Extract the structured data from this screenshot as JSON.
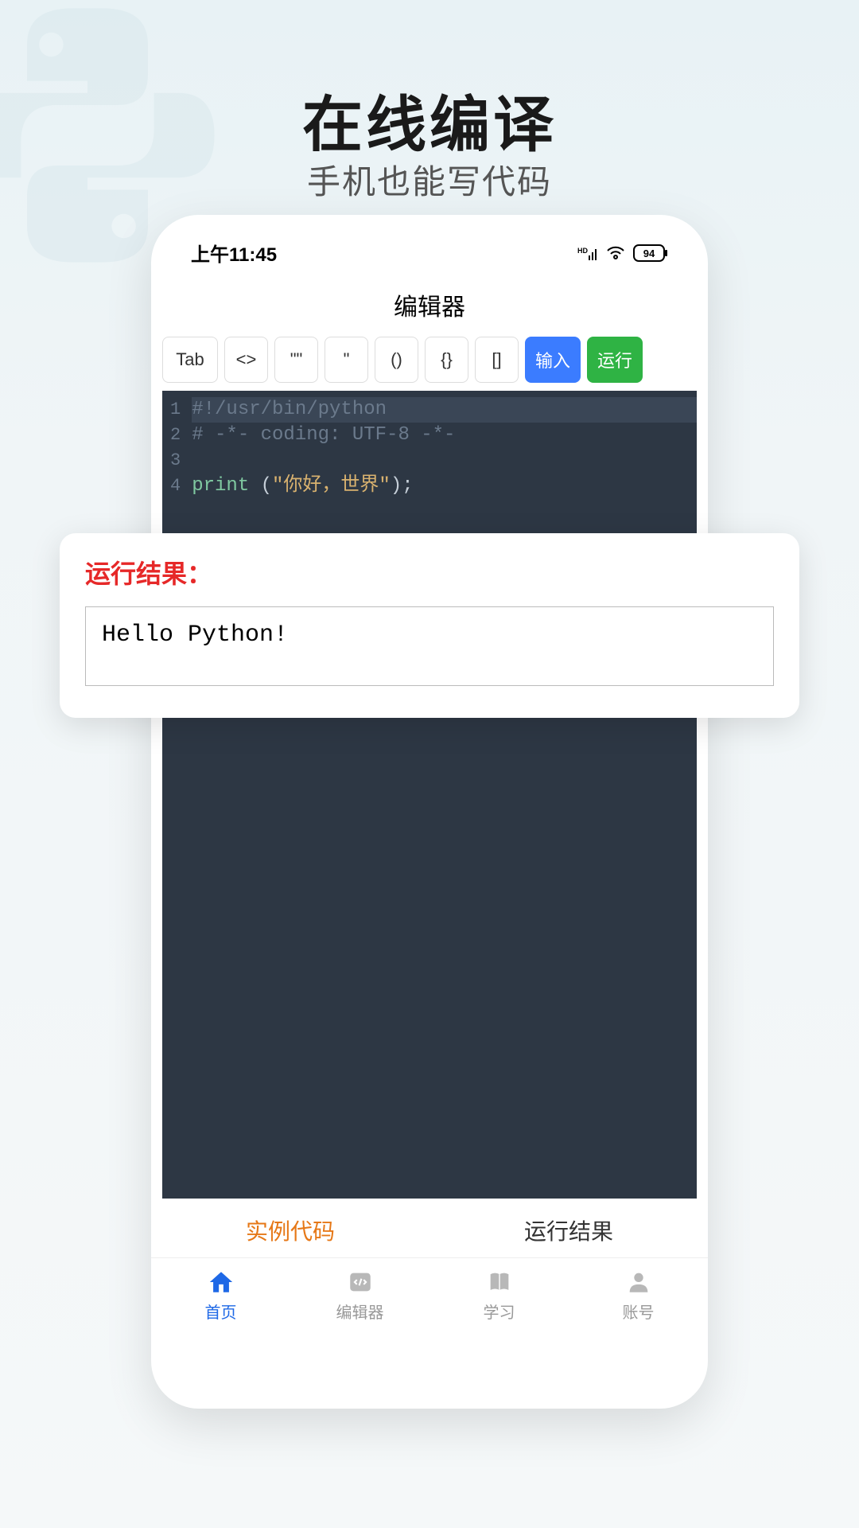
{
  "hero": {
    "title": "在线编译",
    "subtitle": "手机也能写代码"
  },
  "status_bar": {
    "time": "上午11:45",
    "battery": "94"
  },
  "app_title": "编辑器",
  "toolbar": {
    "tab": "Tab",
    "angle": "<>",
    "dquote": "\"\"",
    "squote": "\"",
    "paren": "()",
    "brace": "{}",
    "bracket": "[]",
    "input": "输入",
    "run": "运行"
  },
  "code": {
    "line1": "#!/usr/bin/python",
    "line2": "# -*- coding: UTF-8 -*-",
    "line4_keyword": "print",
    "line4_string": "\"你好，世界\"",
    "line4_open": " (",
    "line4_close": ");"
  },
  "line_numbers": [
    "1",
    "2",
    "3",
    "4"
  ],
  "tabs": {
    "example": "实例代码",
    "result": "运行结果"
  },
  "bottom_nav": {
    "home": "首页",
    "editor": "编辑器",
    "learn": "学习",
    "account": "账号"
  },
  "result": {
    "title": "运行结果：",
    "output": "Hello Python!"
  }
}
